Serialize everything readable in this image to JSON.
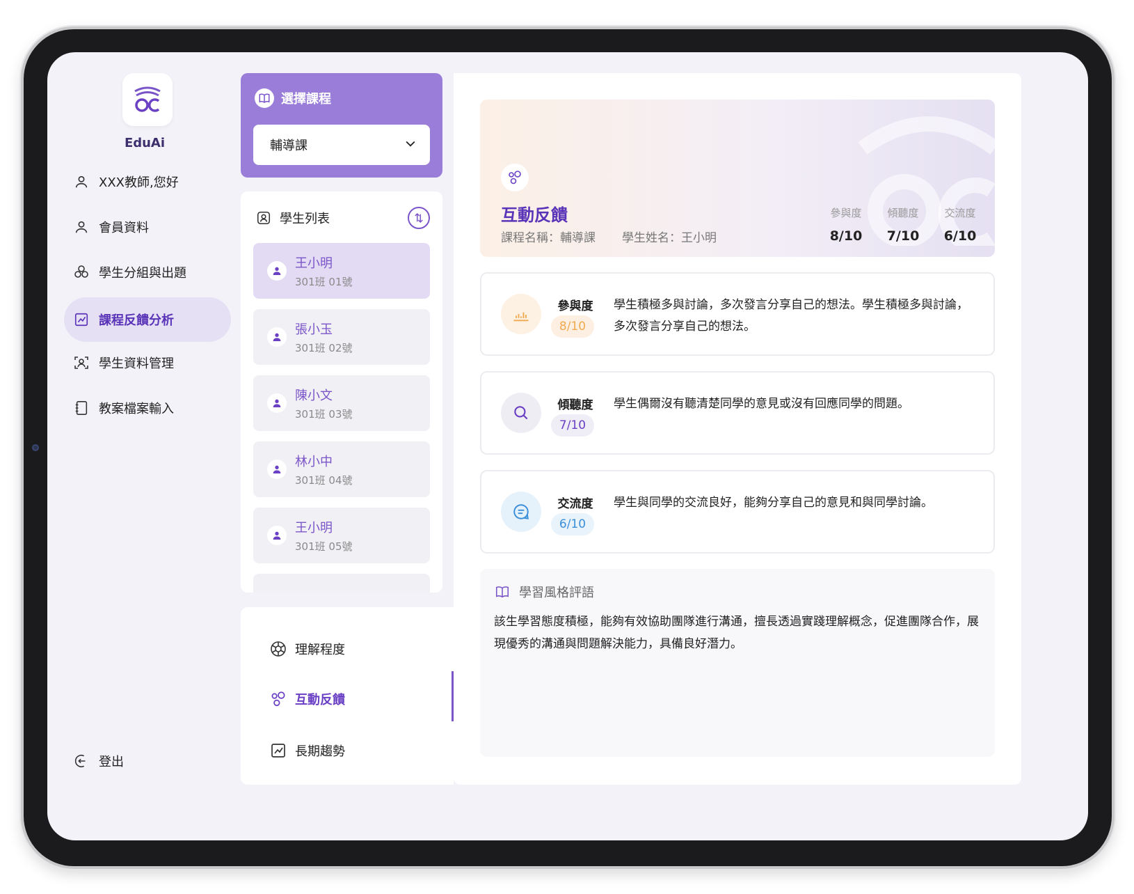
{
  "brand": {
    "name": "EduAi"
  },
  "sidebar": {
    "items": [
      {
        "label": "XXX教師,您好",
        "icon": "user-icon"
      },
      {
        "label": "會員資料",
        "icon": "user-icon"
      },
      {
        "label": "學生分組與出題",
        "icon": "group-icon"
      },
      {
        "label": "課程反饋分析",
        "icon": "chart-icon",
        "active": true
      },
      {
        "label": "學生資料管理",
        "icon": "scan-user-icon"
      },
      {
        "label": "教案檔案輸入",
        "icon": "notebook-icon"
      }
    ],
    "logout": {
      "label": "登出",
      "icon": "logout-icon"
    }
  },
  "course": {
    "title": "選擇課程",
    "selected": "輔導課"
  },
  "student_list": {
    "title": "學生列表",
    "students": [
      {
        "name": "王小明",
        "class": "301班 01號",
        "selected": true
      },
      {
        "name": "張小玉",
        "class": "301班 02號"
      },
      {
        "name": "陳小文",
        "class": "301班 03號"
      },
      {
        "name": "林小中",
        "class": "301班 04號"
      },
      {
        "name": "王小明",
        "class": "301班 05號"
      }
    ]
  },
  "tabs": [
    {
      "label": "理解程度",
      "icon": "aperture-icon"
    },
    {
      "label": "互動反饋",
      "icon": "bubbles-icon",
      "active": true
    },
    {
      "label": "長期趨勢",
      "icon": "trend-icon"
    }
  ],
  "hero": {
    "title": "互動反饋",
    "course_name": "課程名稱：輔導課",
    "student_name": "學生姓名：王小明",
    "scores": [
      {
        "label": "參與度",
        "value": "8/10"
      },
      {
        "label": "傾聽度",
        "value": "7/10"
      },
      {
        "label": "交流度",
        "value": "6/10"
      }
    ]
  },
  "metrics": [
    {
      "label": "參與度",
      "score": "8/10",
      "icon": "bar-chart-icon",
      "color": "#f0a94e",
      "bg": "#fdf1e4",
      "pill_bg": "#fdf0e2",
      "desc": "學生積極多與討論，多次發言分享自己的想法。學生積極多與討論，多次發言分享自己的想法。"
    },
    {
      "label": "傾聽度",
      "score": "7/10",
      "icon": "search-icon",
      "color": "#6a40c4",
      "bg": "#efedf4",
      "pill_bg": "#efedf5",
      "desc": "學生偶爾沒有聽清楚同學的意見或沒有回應同學的問題。"
    },
    {
      "label": "交流度",
      "score": "6/10",
      "icon": "chat-icon",
      "color": "#3b8fd9",
      "bg": "#e6f2fb",
      "pill_bg": "#e8f3fc",
      "desc": "學生與同學的交流良好，能夠分享自己的意見和與同學討論。"
    }
  ],
  "learning_style": {
    "title": "學習風格評語",
    "body": "該生學習態度積極，能夠有效協助團隊進行溝通，擅長透過實踐理解概念，促進團隊合作，展現優秀的溝通與問題解決能力，具備良好潛力。"
  }
}
